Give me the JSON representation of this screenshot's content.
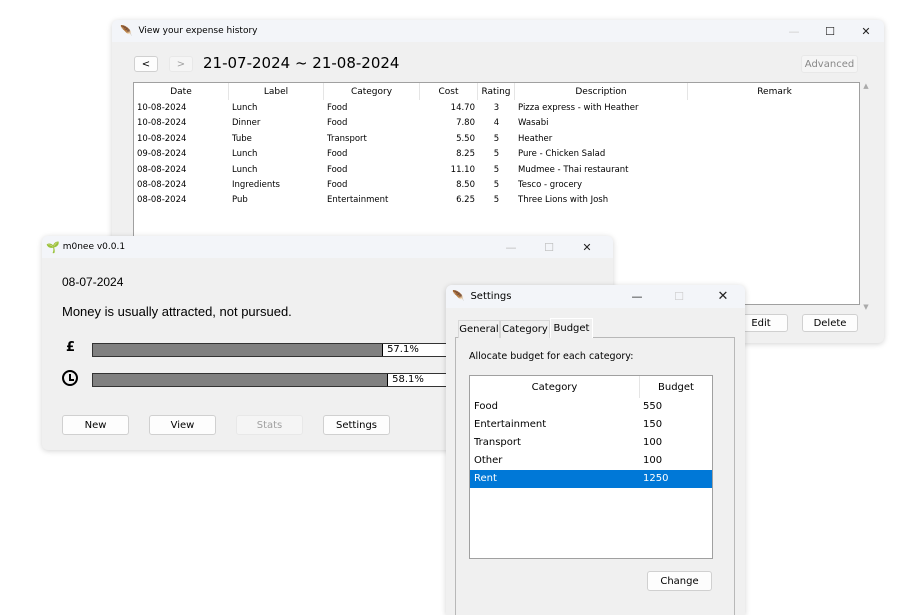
{
  "history": {
    "title": "View your expense history",
    "prev_label": "<",
    "next_label": ">",
    "date_range": "21-07-2024 ~ 21-08-2024",
    "advanced_label": "Advanced",
    "edit_label": "Edit",
    "delete_label": "Delete",
    "columns": [
      "Date",
      "Label",
      "Category",
      "Cost",
      "Rating",
      "Description",
      "Remark"
    ],
    "rows": [
      [
        "10-08-2024",
        "Lunch",
        "Food",
        "14.70",
        "3",
        "Pizza express - with Heather",
        ""
      ],
      [
        "10-08-2024",
        "Dinner",
        "Food",
        "7.80",
        "4",
        "Wasabi",
        ""
      ],
      [
        "10-08-2024",
        "Tube",
        "Transport",
        "5.50",
        "5",
        "Heather",
        ""
      ],
      [
        "09-08-2024",
        "Lunch",
        "Food",
        "8.25",
        "5",
        "Pure - Chicken Salad",
        ""
      ],
      [
        "08-08-2024",
        "Lunch",
        "Food",
        "11.10",
        "5",
        "Mudmee - Thai restaurant",
        ""
      ],
      [
        "08-08-2024",
        "Ingredients",
        "Food",
        "8.50",
        "5",
        "Tesco - grocery",
        ""
      ],
      [
        "08-08-2024",
        "Pub",
        "Entertainment",
        "6.25",
        "5",
        "Three Lions with Josh",
        ""
      ]
    ]
  },
  "main": {
    "title": "m0nee v0.0.1",
    "date": "08-07-2024",
    "quote": "Money is usually attracted, not pursued.",
    "budget_icon": "£",
    "budget_progress": 57.1,
    "budget_label": "57.1%",
    "time_progress": 58.1,
    "time_label": "58.1%",
    "buttons": {
      "new": "New",
      "view": "View",
      "stats": "Stats",
      "settings": "Settings"
    }
  },
  "settings": {
    "title": "Settings",
    "tabs": [
      "General",
      "Category",
      "Budget"
    ],
    "active_tab": "Budget",
    "prompt": "Allocate budget for each category:",
    "columns": [
      "Category",
      "Budget"
    ],
    "rows": [
      [
        "Food",
        "550"
      ],
      [
        "Entertainment",
        "150"
      ],
      [
        "Transport",
        "100"
      ],
      [
        "Other",
        "100"
      ],
      [
        "Rent",
        "1250"
      ]
    ],
    "selected": "Rent",
    "change_label": "Change",
    "selection_color": "#0078d7"
  }
}
